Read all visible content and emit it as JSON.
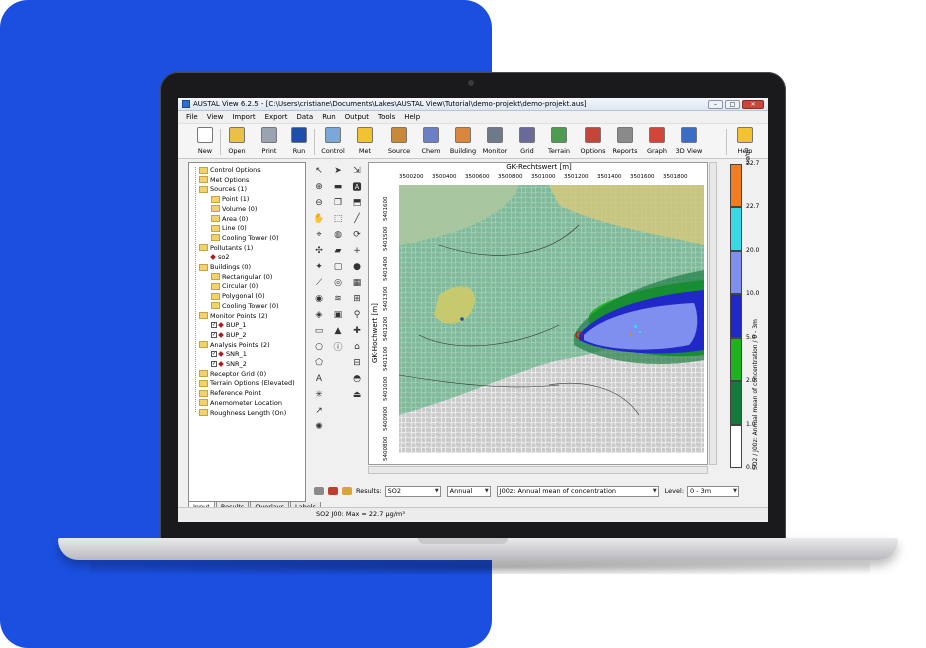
{
  "window": {
    "title": "AUSTAL View 6.2.5 - [C:\\Users\\cristiane\\Documents\\Lakes\\AUSTAL View\\Tutorial\\demo-projekt\\demo-projekt.aus]"
  },
  "menu": [
    "File",
    "View",
    "Import",
    "Export",
    "Data",
    "Run",
    "Output",
    "Tools",
    "Help"
  ],
  "toolbar": [
    {
      "label": "New",
      "icon": "new-file-icon",
      "color": "#ffffff"
    },
    {
      "label": "Open",
      "icon": "open-folder-icon",
      "color": "#e8c04a"
    },
    {
      "label": "Print",
      "icon": "printer-icon",
      "color": "#9aa4b0"
    },
    {
      "label": "Run",
      "icon": "run-arrow-icon",
      "color": "#1e4fa8"
    },
    {
      "label": "Control",
      "icon": "control-icon",
      "color": "#7aa8d8"
    },
    {
      "label": "Met",
      "icon": "sun-icon",
      "color": "#f2c230"
    },
    {
      "label": "Source",
      "icon": "source-icon",
      "color": "#c88a3a"
    },
    {
      "label": "Chem",
      "icon": "chem-icon",
      "color": "#6a7fc4"
    },
    {
      "label": "Building",
      "icon": "building-icon",
      "color": "#d9873f"
    },
    {
      "label": "Monitor",
      "icon": "monitor-icon",
      "color": "#6e7a8a"
    },
    {
      "label": "Grid",
      "icon": "grid-icon",
      "color": "#6a6a9a"
    },
    {
      "label": "Terrain",
      "icon": "terrain-icon",
      "color": "#4e9a4e"
    },
    {
      "label": "Options",
      "icon": "options-icon",
      "color": "#c4463a"
    },
    {
      "label": "Reports",
      "icon": "reports-icon",
      "color": "#8a8a8a"
    },
    {
      "label": "Graph",
      "icon": "graph-icon",
      "color": "#d2463a"
    },
    {
      "label": "3D View",
      "icon": "3d-view-icon",
      "color": "#3a6ec4"
    },
    {
      "label": "Help",
      "icon": "help-icon",
      "color": "#f2c230"
    }
  ],
  "tree": [
    {
      "label": "Control Options",
      "type": "folder",
      "level": 1
    },
    {
      "label": "Met Options",
      "type": "folder",
      "level": 1
    },
    {
      "label": "Sources (1)",
      "type": "folder",
      "level": 1
    },
    {
      "label": "Point (1)",
      "type": "folder",
      "level": 2
    },
    {
      "label": "Volume (0)",
      "type": "folder",
      "level": 2
    },
    {
      "label": "Area (0)",
      "type": "folder",
      "level": 2
    },
    {
      "label": "Line (0)",
      "type": "folder",
      "level": 2
    },
    {
      "label": "Cooling Tower (0)",
      "type": "folder",
      "level": 2
    },
    {
      "label": "Pollutants (1)",
      "type": "folder",
      "level": 1
    },
    {
      "label": "so2",
      "type": "item",
      "level": 2
    },
    {
      "label": "Buildings (0)",
      "type": "folder",
      "level": 1
    },
    {
      "label": "Rectangular (0)",
      "type": "folder",
      "level": 2
    },
    {
      "label": "Circular (0)",
      "type": "folder",
      "level": 2
    },
    {
      "label": "Polygonal (0)",
      "type": "folder",
      "level": 2
    },
    {
      "label": "Cooling Tower (0)",
      "type": "folder",
      "level": 2
    },
    {
      "label": "Monitor Points (2)",
      "type": "folder",
      "level": 1
    },
    {
      "label": "BUP_1",
      "type": "check",
      "level": 2
    },
    {
      "label": "BUP_2",
      "type": "check",
      "level": 2
    },
    {
      "label": "Analysis Points (2)",
      "type": "folder",
      "level": 1
    },
    {
      "label": "SNR_1",
      "type": "check",
      "level": 2
    },
    {
      "label": "SNR_2",
      "type": "check",
      "level": 2
    },
    {
      "label": "Receptor Grid (0)",
      "type": "folder",
      "level": 1
    },
    {
      "label": "Terrain Options (Elevated)",
      "type": "folder",
      "level": 1
    },
    {
      "label": "Reference Point",
      "type": "folder",
      "level": 1
    },
    {
      "label": "Anemometer Location",
      "type": "folder",
      "level": 1
    },
    {
      "label": "Roughness Length (On)",
      "type": "folder",
      "level": 1
    }
  ],
  "tabs": [
    "Input",
    "Results",
    "Overlays",
    "Labels"
  ],
  "map": {
    "x_axis_title": "GK-Rechtswert [m]",
    "y_axis_title": "GK-Hochwert [m]",
    "x_ticks": [
      "3500200",
      "3500400",
      "3500600",
      "3500800",
      "3501000",
      "3501200",
      "3501400",
      "3501600",
      "3501800"
    ],
    "y_ticks": [
      "5401600",
      "5401500",
      "5401400",
      "5401300",
      "5401200",
      "5401100",
      "5401000",
      "5400900",
      "5400800"
    ]
  },
  "legend": {
    "unit": "µg/m³",
    "title": "SO2 / J00z: Annual mean of concentration / 0 - 3m",
    "bands": [
      {
        "label": "22.7",
        "color": "#f07d1f"
      },
      {
        "label": "22.7",
        "color": "#39d8e6"
      },
      {
        "label": "20.0",
        "color": "#7f8ff0"
      },
      {
        "label": "10.0",
        "color": "#2028c8"
      },
      {
        "label": "5.0",
        "color": "#1fb21f"
      },
      {
        "label": "2.0",
        "color": "#177a3d"
      },
      {
        "label": "1.0",
        "color": "#ffffff"
      },
      {
        "label": "0.0",
        "color": ""
      }
    ]
  },
  "results": {
    "label": "Results:",
    "pollutant": "SO2",
    "period": "Annual",
    "statistic": "J00z: Annual mean of concentration",
    "level_label": "Level:",
    "level": "0 - 3m"
  },
  "status": "SO2 J00:  Max = 22.7 µg/m³"
}
